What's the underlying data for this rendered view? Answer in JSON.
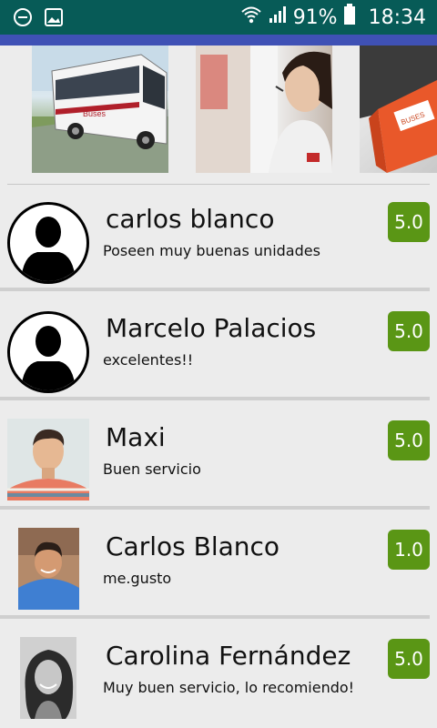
{
  "status_bar": {
    "battery": "91%",
    "time": "18:34",
    "icons": [
      "dnd-icon",
      "image-icon",
      "wifi-icon",
      "signal-icon",
      "battery-icon"
    ]
  },
  "gallery": {
    "images": [
      "bus-photo",
      "call-center-agent-photo",
      "package-box-photo"
    ],
    "bus_logo": "Buses",
    "box_logo": "BUSES"
  },
  "reviews": [
    {
      "name": "carlos blanco",
      "comment": "Poseen muy buenas unidades",
      "rating": "5.0",
      "avatar": "generic"
    },
    {
      "name": "Marcelo Palacios",
      "comment": "excelentes!!",
      "rating": "5.0",
      "avatar": "generic"
    },
    {
      "name": "Maxi",
      "comment": "Buen servicio",
      "rating": "5.0",
      "avatar": "photo"
    },
    {
      "name": "Carlos Blanco",
      "comment": "me.gusto",
      "rating": "1.0",
      "avatar": "photo"
    },
    {
      "name": "Carolina Fernández",
      "comment": "Muy buen servicio, lo recomiendo!",
      "rating": "5.0",
      "avatar": "photo"
    }
  ],
  "colors": {
    "status_bar": "#075b57",
    "app_bar": "#3f51b5",
    "rating_badge": "#5a9615",
    "background": "#ececec"
  }
}
